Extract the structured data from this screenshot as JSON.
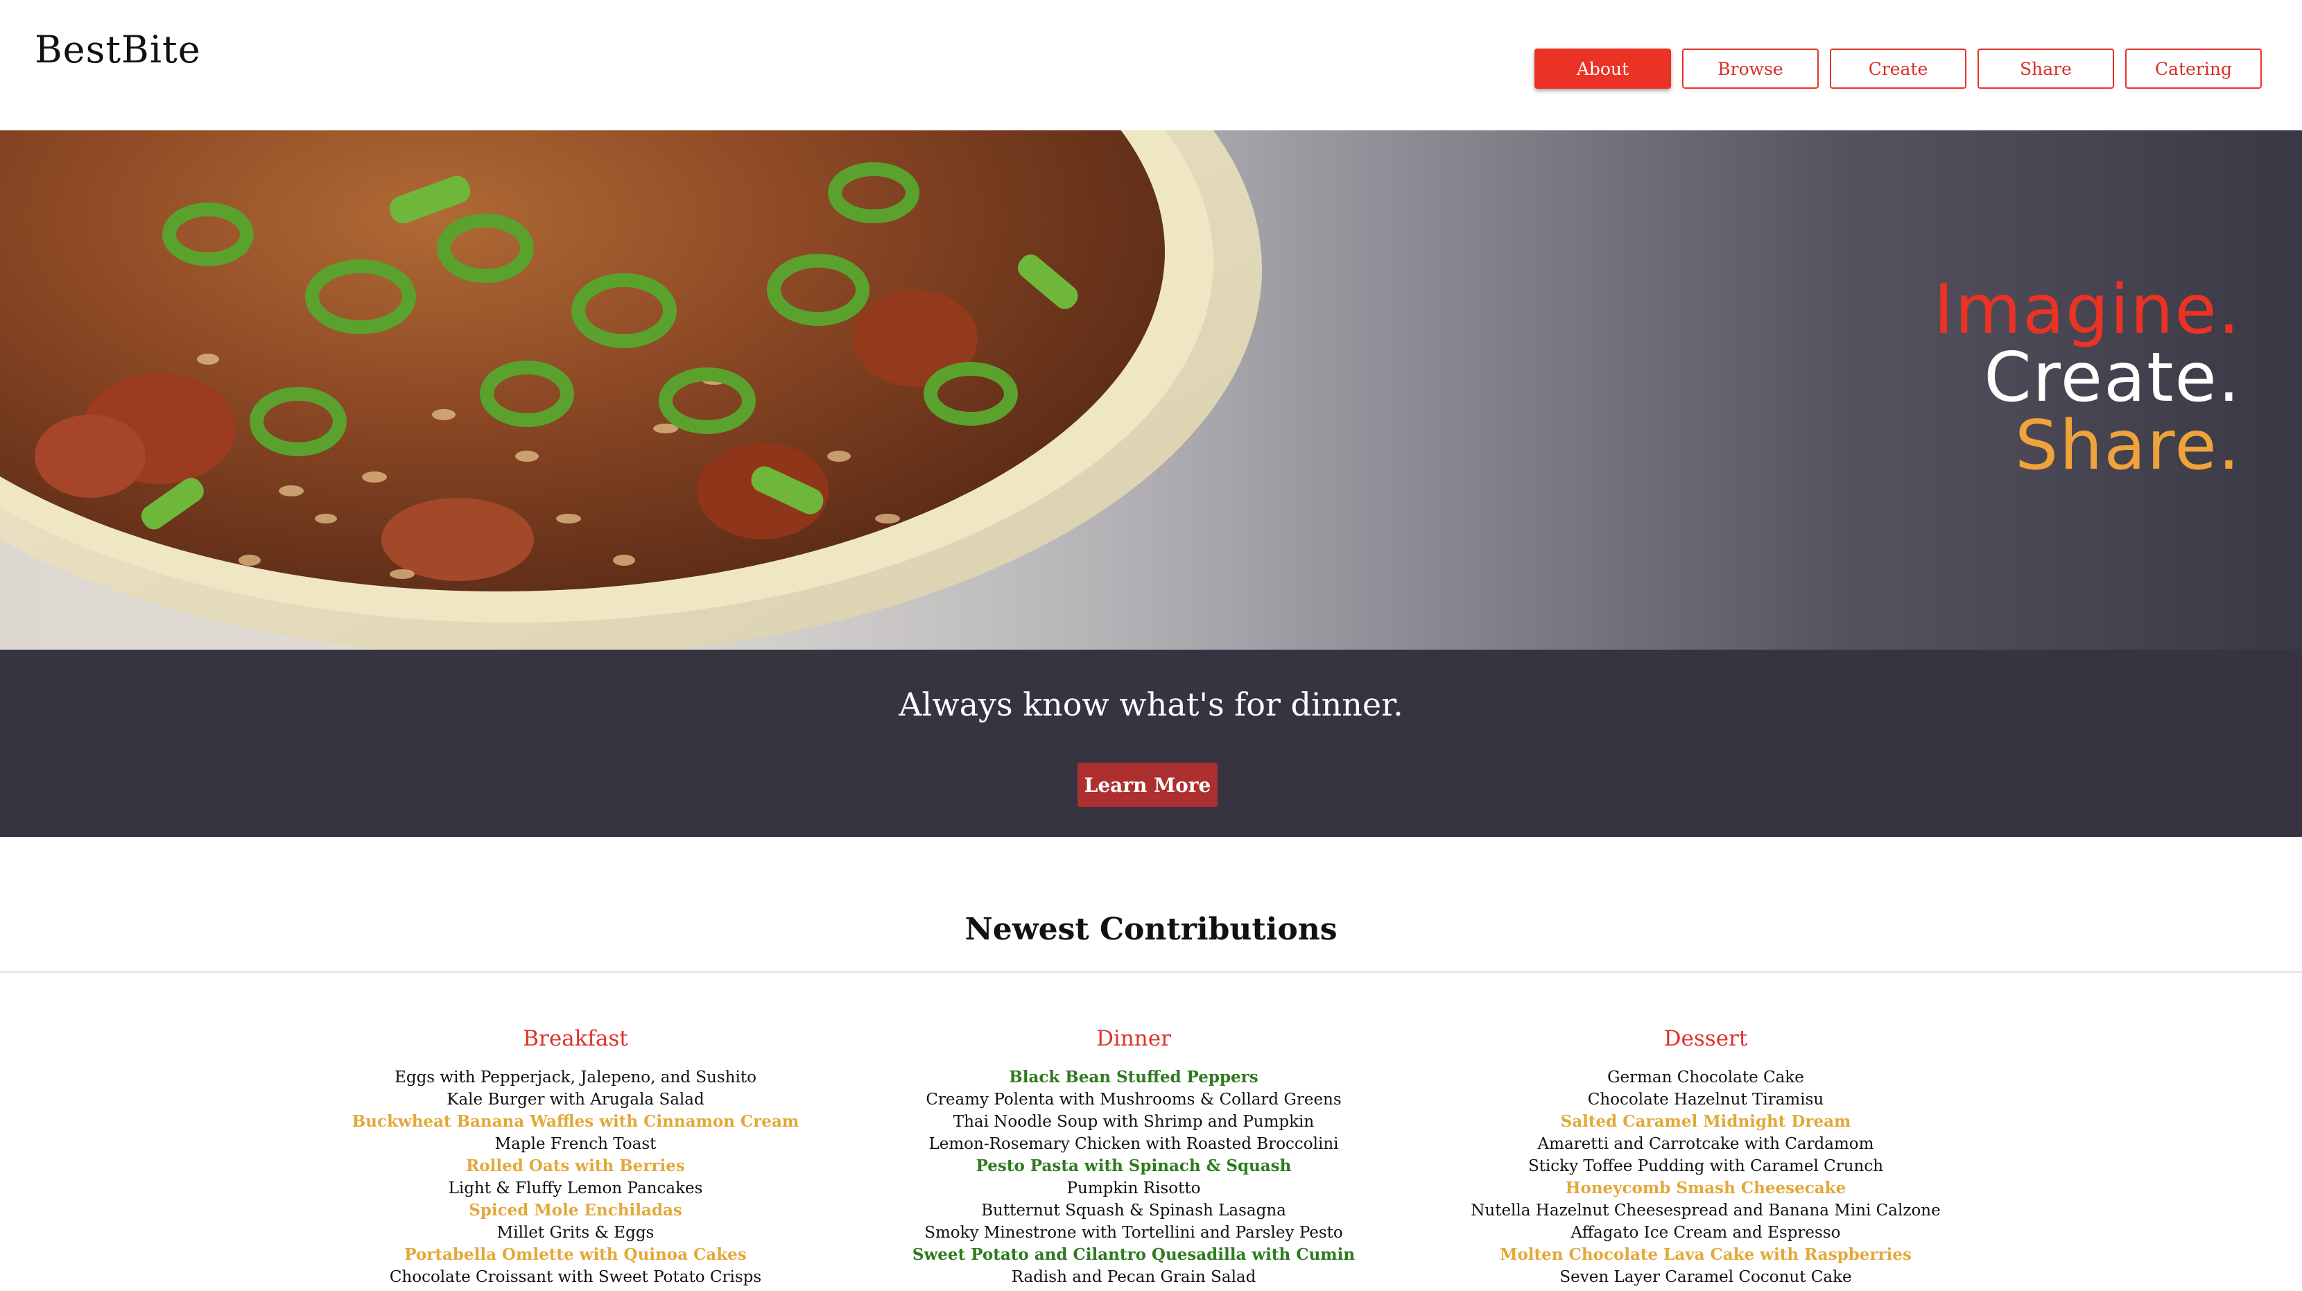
{
  "brand": {
    "name": "BestBite"
  },
  "nav": [
    {
      "label": "About",
      "active": true
    },
    {
      "label": "Browse",
      "active": false
    },
    {
      "label": "Create",
      "active": false
    },
    {
      "label": "Share",
      "active": false
    },
    {
      "label": "Catering",
      "active": false
    }
  ],
  "hero": {
    "line1": "Imagine.",
    "line2": "Create.",
    "line3": "Share.",
    "colors": {
      "line1": "#ea3324",
      "line2": "#ffffff",
      "line3": "#f0a33a"
    }
  },
  "band": {
    "tagline": "Always know what's for dinner.",
    "cta": "Learn More"
  },
  "contributions": {
    "title": "Newest Contributions",
    "breakfast": {
      "title": "Breakfast",
      "items": [
        {
          "text": "Eggs with Pepperjack, Jalepeno, and Sushito",
          "style": "plain"
        },
        {
          "text": "Kale Burger with Arugala Salad",
          "style": "plain"
        },
        {
          "text": "Buckwheat Banana Waffles with Cinnamon Cream",
          "style": "gold"
        },
        {
          "text": "Maple French Toast",
          "style": "plain"
        },
        {
          "text": "Rolled Oats with Berries",
          "style": "gold"
        },
        {
          "text": "Light & Fluffy Lemon Pancakes",
          "style": "plain"
        },
        {
          "text": "Spiced Mole Enchiladas",
          "style": "gold"
        },
        {
          "text": "Millet Grits & Eggs",
          "style": "plain"
        },
        {
          "text": "Portabella Omlette with Quinoa Cakes",
          "style": "gold"
        },
        {
          "text": "Chocolate Croissant with Sweet Potato Crisps",
          "style": "plain"
        }
      ]
    },
    "dinner": {
      "title": "Dinner",
      "items": [
        {
          "text": "Black Bean Stuffed Peppers",
          "style": "green"
        },
        {
          "text": "Creamy Polenta with Mushrooms & Collard Greens",
          "style": "plain"
        },
        {
          "text": "Thai Noodle Soup with Shrimp and Pumpkin",
          "style": "plain"
        },
        {
          "text": "Lemon-Rosemary Chicken with Roasted Broccolini",
          "style": "plain"
        },
        {
          "text": "Pesto Pasta with Spinach & Squash",
          "style": "green"
        },
        {
          "text": "Pumpkin Risotto",
          "style": "plain"
        },
        {
          "text": "Butternut Squash & Spinash Lasagna",
          "style": "plain"
        },
        {
          "text": "Smoky Minestrone with Tortellini and Parsley Pesto",
          "style": "plain"
        },
        {
          "text": "Sweet Potato and Cilantro Quesadilla with Cumin",
          "style": "green"
        },
        {
          "text": "Radish and Pecan Grain Salad",
          "style": "plain"
        }
      ]
    },
    "dessert": {
      "title": "Dessert",
      "items": [
        {
          "text": "German Chocolate Cake",
          "style": "plain"
        },
        {
          "text": "Chocolate Hazelnut Tiramisu",
          "style": "plain"
        },
        {
          "text": "Salted Caramel Midnight Dream",
          "style": "gold"
        },
        {
          "text": "Amaretti and Carrotcake with Cardamom",
          "style": "plain"
        },
        {
          "text": "Sticky Toffee Pudding with Caramel Crunch",
          "style": "plain"
        },
        {
          "text": "Honeycomb Smash Cheesecake",
          "style": "gold"
        },
        {
          "text": "Nutella Hazelnut Cheesespread and Banana Mini Calzone",
          "style": "plain"
        },
        {
          "text": "Affagato Ice Cream and Espresso",
          "style": "plain"
        },
        {
          "text": "Molten Chocolate Lava Cake with Raspberries",
          "style": "gold"
        },
        {
          "text": "Seven Layer Caramel Coconut Cake",
          "style": "plain"
        }
      ]
    }
  }
}
